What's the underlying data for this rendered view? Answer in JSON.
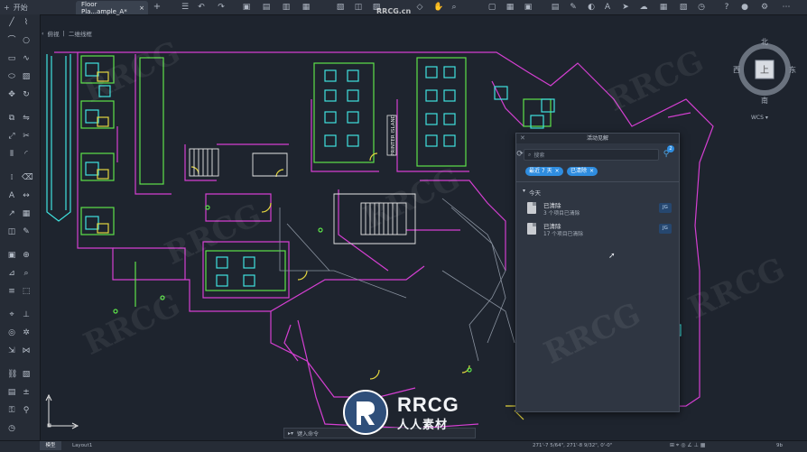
{
  "header": {
    "home_label": "开始",
    "file_tab_title": "Floor Pla...ample_A*",
    "add_tab": "+"
  },
  "breadcrumb": {
    "view": "俯视",
    "style": "二维线框"
  },
  "drawing": {
    "printer_label": "PRINTER ISLAND"
  },
  "compass": {
    "north": "北",
    "south": "南",
    "east": "东",
    "west": "西",
    "face": "上",
    "wcs": "WCS"
  },
  "activity_panel": {
    "title": "活动见解",
    "search_placeholder": "搜索",
    "filter_count": "2",
    "chips": [
      "最近 7 天",
      "已清除"
    ],
    "group_label": "今天",
    "items": [
      {
        "title": "已清除",
        "subtitle": "3 个项目已清除",
        "avatar": "JG"
      },
      {
        "title": "已清除",
        "subtitle": "17 个项目已清除",
        "avatar": "JG"
      }
    ]
  },
  "command_line": {
    "placeholder": "键入命令"
  },
  "status_bar": {
    "model_tab": "模型",
    "layout_tab": "Layout1",
    "coordinates": "271'-7 5/64\", 271'-8 9/32\", 0'-0\"",
    "zoom_label": "9b"
  },
  "watermarks": {
    "top_url": "RRCG.cn",
    "logo_title": "RRCG",
    "logo_subtitle": "人人素材",
    "overlay": "RRCG"
  },
  "colors": {
    "wall": "#d43fd1",
    "furniture_cyan": "#3fe3e0",
    "furniture_green": "#5de34a",
    "door_yellow": "#e3d53f",
    "stairs_white": "#e6e6e6",
    "accent": "#2f8de0"
  }
}
